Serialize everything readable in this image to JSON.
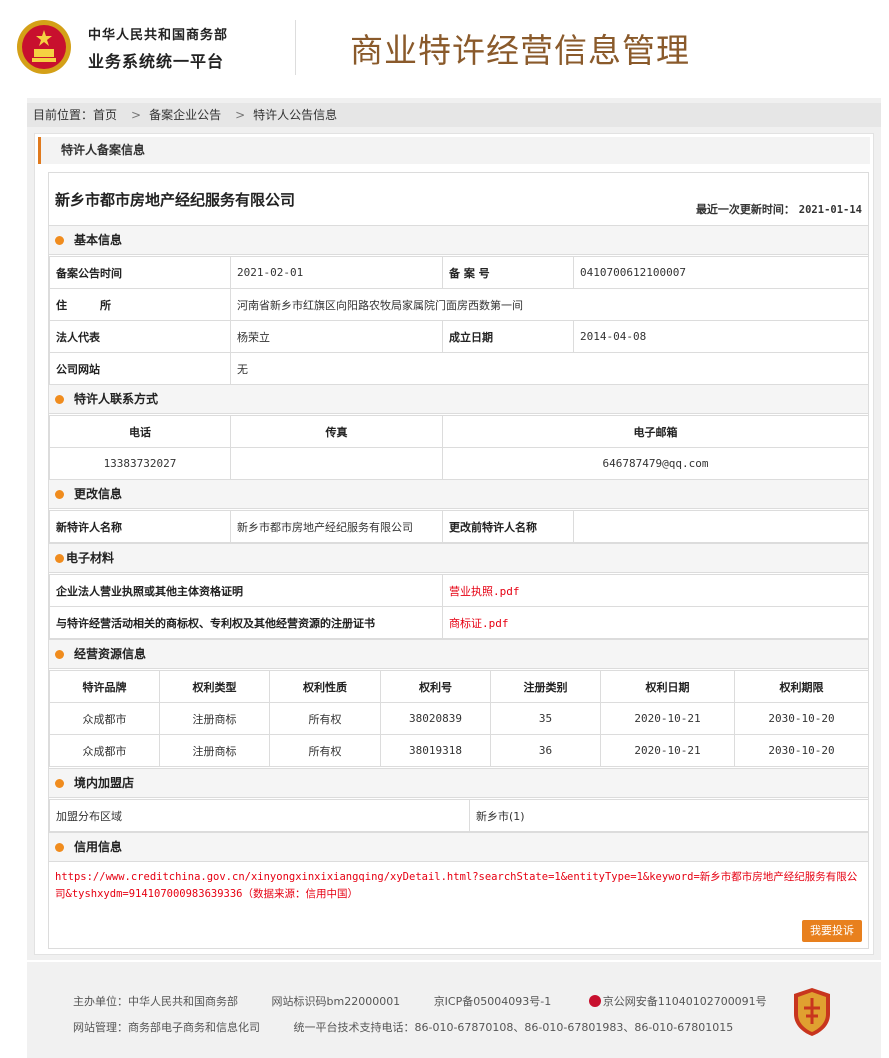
{
  "header": {
    "org_line1": "中华人民共和国商务部",
    "org_line2": "业务系统统一平台",
    "system_title": "商业特许经营信息管理"
  },
  "breadcrumb": {
    "prefix": "目前位置：",
    "items": [
      "首页",
      "备案企业公告",
      "特许人公告信息"
    ]
  },
  "section_tab": "特许人备案信息",
  "company": {
    "name": "新乡市都市房地产经纪服务有限公司",
    "updated_label": "最近一次更新时间：",
    "updated_value": "2021-01-14"
  },
  "basic": {
    "title": "基本信息",
    "announce_label": "备案公告时间",
    "announce_value": "2021-02-01",
    "record_no_label": "备 案 号",
    "record_no_value": "0410700612100007",
    "address_label": "住　　　所",
    "address_value": "河南省新乡市红旗区向阳路农牧局家属院门面房西数第一间",
    "legal_rep_label": "法人代表",
    "legal_rep_value": "杨荣立",
    "founded_label": "成立日期",
    "founded_value": "2014-04-08",
    "website_label": "公司网站",
    "website_value": "无"
  },
  "contact": {
    "title": "特许人联系方式",
    "phone_label": "电话",
    "fax_label": "传真",
    "email_label": "电子邮箱",
    "phone_value": "13383732027",
    "fax_value": "",
    "email_value": "646787479@qq.com"
  },
  "change": {
    "title": "更改信息",
    "new_name_label": "新特许人名称",
    "new_name_value": "新乡市都市房地产经纪服务有限公司",
    "old_name_label": "更改前特许人名称",
    "old_name_value": ""
  },
  "materials": {
    "title": "电子材料",
    "license_label": "企业法人营业执照或其他主体资格证明",
    "license_file": "营业执照.pdf",
    "trademark_label": "与特许经营活动相关的商标权、专利权及其他经营资源的注册证书",
    "trademark_file": "商标证.pdf"
  },
  "resources": {
    "title": "经营资源信息",
    "headers": [
      "特许品牌",
      "权利类型",
      "权利性质",
      "权利号",
      "注册类别",
      "权利日期",
      "权利期限"
    ],
    "rows": [
      [
        "众成都市",
        "注册商标",
        "所有权",
        "38020839",
        "35",
        "2020-10-21",
        "2030-10-20"
      ],
      [
        "众成都市",
        "注册商标",
        "所有权",
        "38019318",
        "36",
        "2020-10-21",
        "2030-10-20"
      ]
    ]
  },
  "franchise": {
    "title": "境内加盟店",
    "area_label": "加盟分布区域",
    "area_value": "新乡市(1)"
  },
  "credit": {
    "title": "信用信息",
    "text": "https://www.creditchina.gov.cn/xinyongxinxixiangqing/xyDetail.html?searchState=1&entityType=1&keyword=新乡市都市房地产经纪服务有限公司&tyshxydm=914107000983639336（数据来源：信用中国）"
  },
  "complain_button": "我要投诉",
  "footer": {
    "sponsor": "主办单位：中华人民共和国商务部",
    "site_code": "网站标识码bm22000001",
    "icp": "京ICP备05004093号-1",
    "police": "京公网安备11040102700091号",
    "maintainer": "网站管理：商务部电子商务和信息化司",
    "hotline": "统一平台技术支持电话：86-010-67870108、86-010-67801983、86-010-67801015"
  },
  "colors": {
    "accent": "#e8801e",
    "title_brown": "#8a5a2b",
    "link_red": "#e60012"
  }
}
